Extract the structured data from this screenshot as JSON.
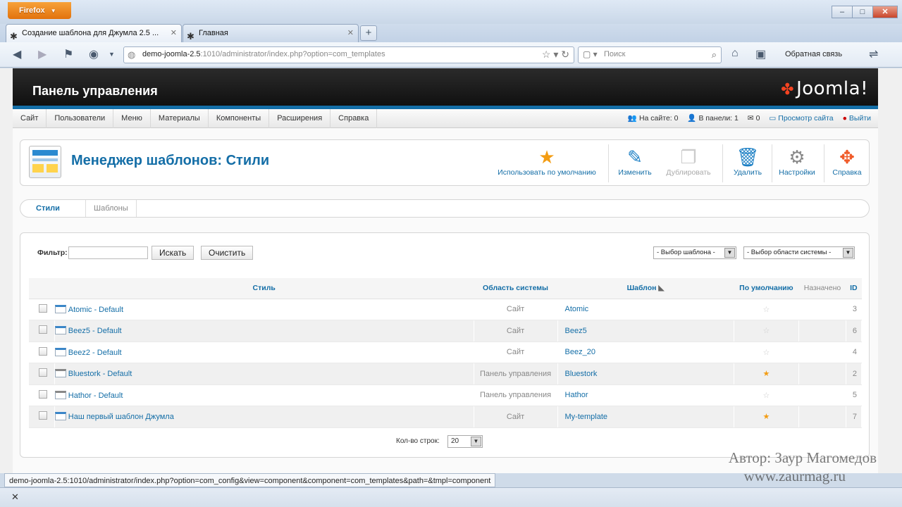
{
  "browser": {
    "app_button": "Firefox",
    "tabs": [
      {
        "label": "Создание шаблона для Джумла 2.5 ..."
      },
      {
        "label": "Главная"
      }
    ],
    "url_host": "demo-joomla-2.5",
    "url_rest": ":1010/administrator/index.php?option=com_templates",
    "search_placeholder": "Поиск",
    "feedback": "Обратная связь",
    "status_url": "demo-joomla-2.5:1010/administrator/index.php?option=com_config&view=component&component=com_templates&path=&tmpl=component"
  },
  "header": {
    "title": "Панель управления",
    "logo": "Joomla!"
  },
  "menu": [
    "Сайт",
    "Пользователи",
    "Меню",
    "Материалы",
    "Компоненты",
    "Расширения",
    "Справка"
  ],
  "status": {
    "online": "На сайте: 0",
    "admins": "В панели: 1",
    "messages": "0",
    "view_site": "Просмотр сайта",
    "logout": "Выйти"
  },
  "page": {
    "heading": "Менеджер шаблонов: Стили"
  },
  "toolbar": {
    "default": "Использовать по умолчанию",
    "edit": "Изменить",
    "duplicate": "Дублировать",
    "delete": "Удалить",
    "options": "Настройки",
    "help": "Справка"
  },
  "subtabs": {
    "styles": "Стили",
    "templates": "Шаблоны"
  },
  "filter": {
    "label": "Фильтр:",
    "value": "",
    "search_btn": "Искать",
    "clear_btn": "Очистить",
    "template_select": "- Выбор шаблона -",
    "location_select": "- Выбор области системы -"
  },
  "table": {
    "headers": {
      "style": "Стиль",
      "location": "Область системы",
      "template": "Шаблон",
      "default": "По умолчанию",
      "assigned": "Назначено",
      "id": "ID"
    },
    "rows": [
      {
        "style": "Atomic - Default",
        "location": "Сайт",
        "template": "Atomic",
        "default": false,
        "id": "3"
      },
      {
        "style": "Beez5 - Default",
        "location": "Сайт",
        "template": "Beez5",
        "default": false,
        "id": "6"
      },
      {
        "style": "Beez2 - Default",
        "location": "Сайт",
        "template": "Beez_20",
        "default": false,
        "id": "4"
      },
      {
        "style": "Bluestork - Default",
        "location": "Панель управления",
        "template": "Bluestork",
        "default": true,
        "id": "2"
      },
      {
        "style": "Hathor - Default",
        "location": "Панель управления",
        "template": "Hathor",
        "default": false,
        "id": "5"
      },
      {
        "style": "Наш первый шаблон Джумла",
        "location": "Сайт",
        "template": "My-template",
        "default": true,
        "id": "7"
      }
    ]
  },
  "pagination": {
    "rows_label": "Кол-во строк:",
    "rows_value": "20"
  },
  "watermark": {
    "author": "Автор: Заур Магомедов",
    "site": "www.zaurmag.ru"
  },
  "colors": {
    "accent": "#146ea7",
    "star_on": "#f39c12",
    "firefox": "#e2720c"
  }
}
